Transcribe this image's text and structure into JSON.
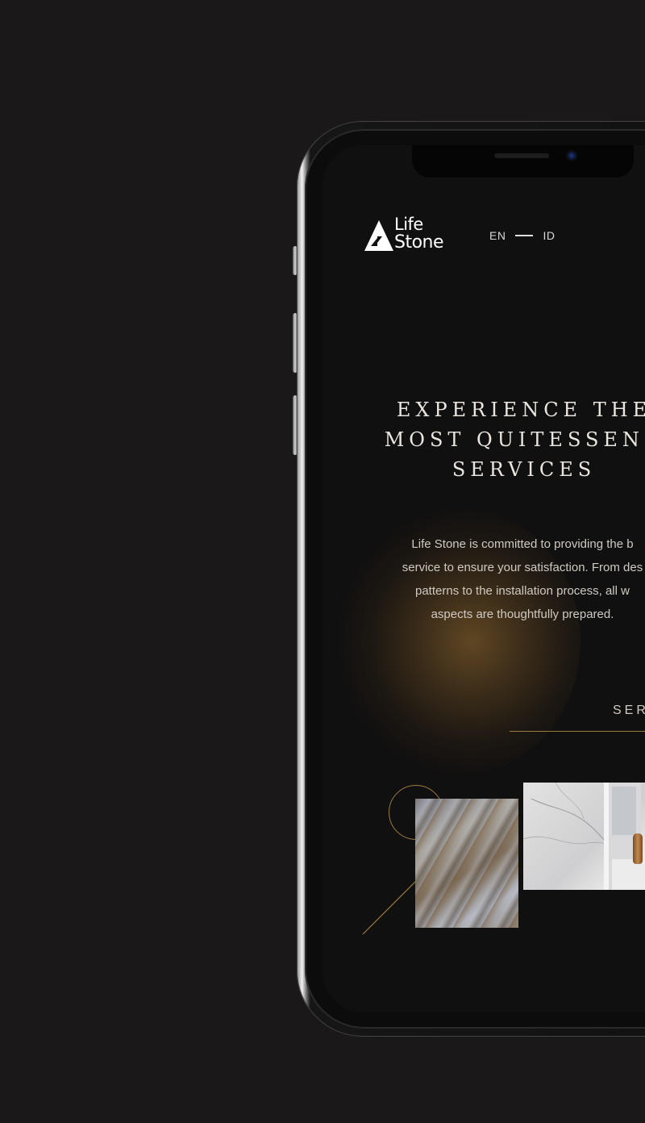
{
  "header": {
    "logo_line1": "Life",
    "logo_line2": "Stone",
    "lang_en": "EN",
    "lang_id": "ID"
  },
  "hero": {
    "title_lines": [
      "EXPERIENCE THE",
      "MOST QUITESSENC",
      "SERVICES"
    ],
    "description_lines": [
      "Life Stone is committed to providing the b",
      "service to ensure your satisfaction. From des",
      "patterns to the installation process, all w",
      "aspects are thoughtfully prepared."
    ],
    "services_link": "SER"
  },
  "colors": {
    "background": "#1a1819",
    "screen": "#111010",
    "gold_accent": "#9b7a3e",
    "text": "#eae6df"
  },
  "icons": {
    "logo": "lifestone-triangle-logo"
  }
}
